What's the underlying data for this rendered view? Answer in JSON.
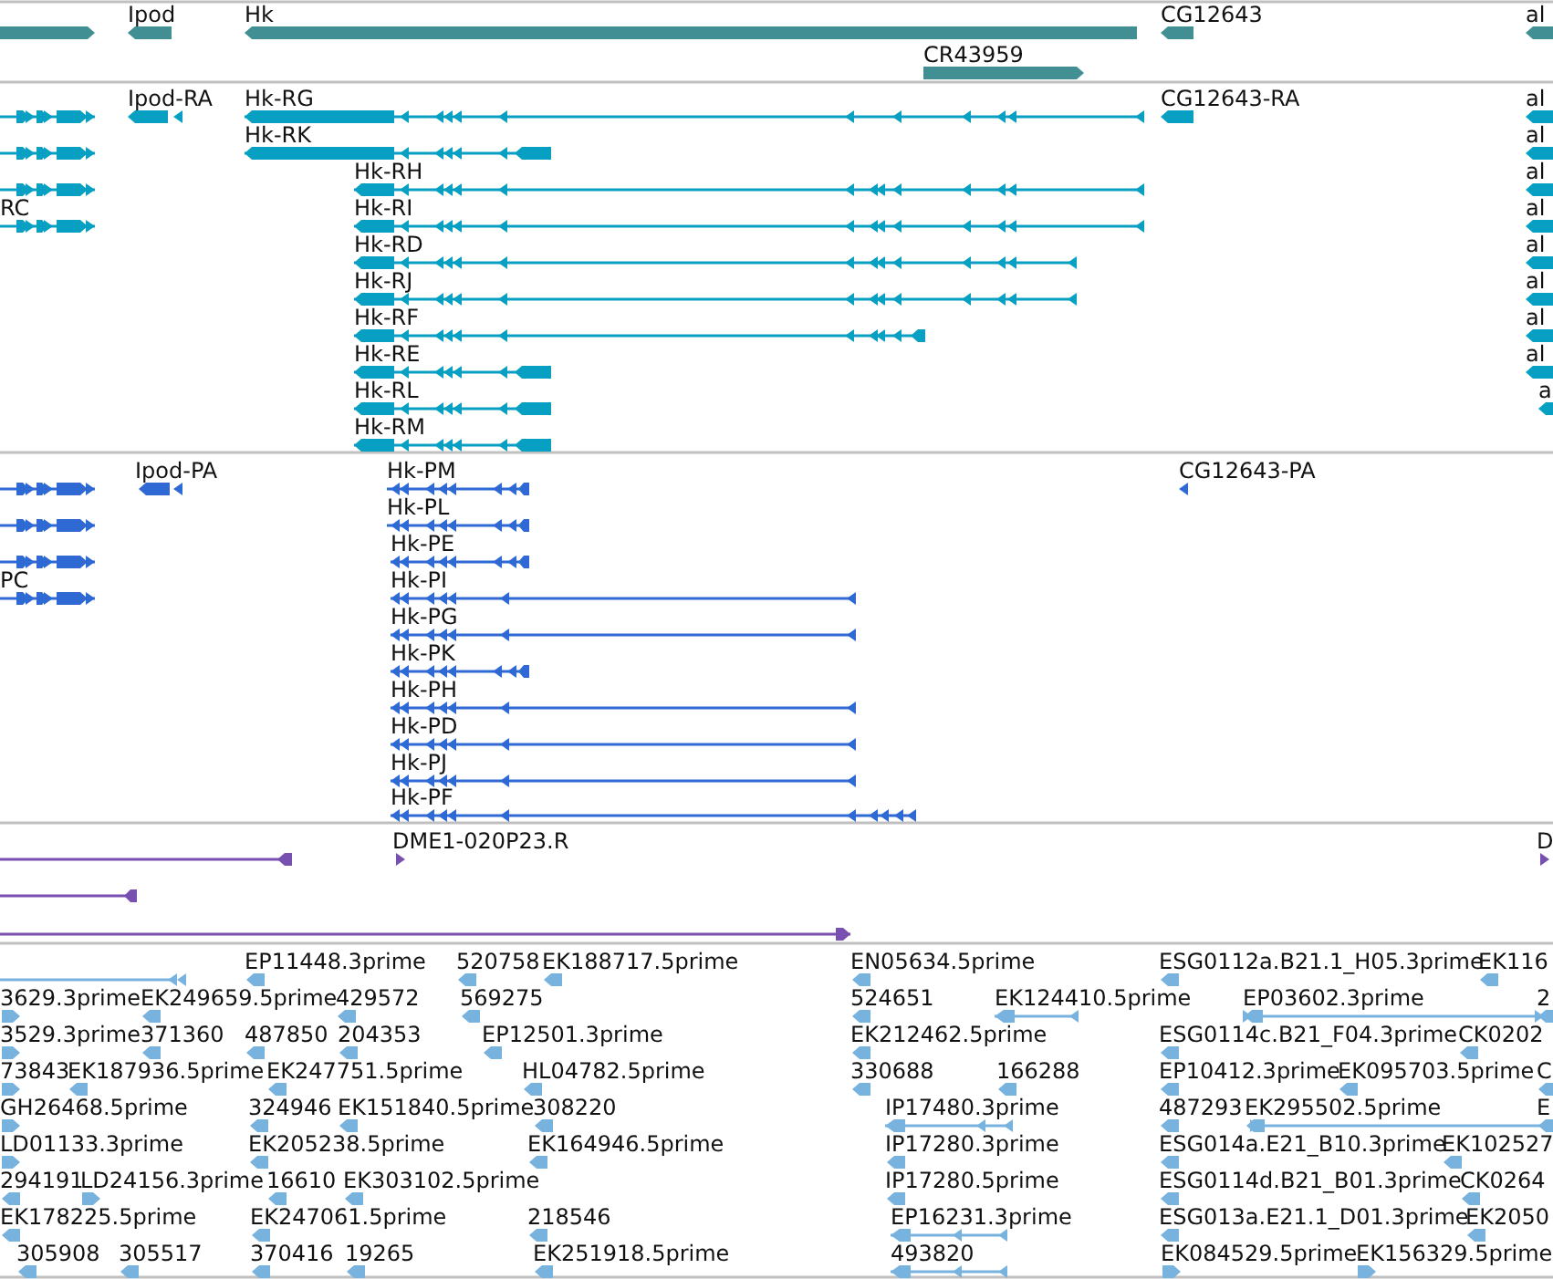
{
  "tracks": [
    {
      "kind": "gene",
      "labels": [
        "Ipod",
        "Hk",
        "CR43959",
        "CG12643",
        "al"
      ]
    },
    {
      "kind": "transcript",
      "labels": [
        "Ipod-RA",
        "Hk-RG",
        "Hk-RK",
        "Hk-RH",
        "Hk-RI",
        "Hk-RD",
        "Hk-RJ",
        "Hk-RF",
        "Hk-RE",
        "Hk-RL",
        "Hk-RM",
        "CG12643-RA",
        "RC",
        "al",
        "al",
        "al",
        "al",
        "al",
        "al",
        "al",
        "al",
        "a"
      ]
    },
    {
      "kind": "protein",
      "labels": [
        "Ipod-PA",
        "Hk-PM",
        "Hk-PL",
        "Hk-PE",
        "Hk-PI",
        "Hk-PG",
        "Hk-PK",
        "Hk-PH",
        "Hk-PD",
        "Hk-PJ",
        "Hk-PF",
        "CG12643-PA",
        "PC"
      ]
    },
    {
      "kind": "clone",
      "labels": [
        "DME1-020P23.R",
        "D"
      ]
    },
    {
      "kind": "est",
      "labels": [
        "EP11448.3prime",
        "520758",
        "EK188717.5prime",
        "EN05634.5prime",
        "ESG0112a.B21.1_H05.3prime",
        "EK116",
        "3629.3prime",
        "EK249659.5prime",
        "429572",
        "569275",
        "524651",
        "EK124410.5prime",
        "EP03602.3prime",
        "2",
        "3529.3prime",
        "371360",
        "487850",
        "204353",
        "EP12501.3prime",
        "EK212462.5prime",
        "ESG0114c.B21_F04.3prime",
        "CK0202",
        "73843",
        "EK187936.5prime",
        "EK247751.5prime",
        "HL04782.5prime",
        "330688",
        "166288",
        "EP10412.3prime",
        "EK095703.5prime",
        "C",
        "GH26468.5prime",
        "324946",
        "EK151840.5prime",
        "308220",
        "IP17480.3prime",
        "487293",
        "EK295502.5prime",
        "E",
        "LD01133.3prime",
        "EK205238.5prime",
        "EK164946.5prime",
        "IP17280.3prime",
        "ESG014a.E21_B10.3prime",
        "EK102527",
        "294191",
        "LD24156.3prime",
        "16610",
        "EK303102.5prime",
        "IP17280.5prime",
        "ESG0114d.B21_B01.3prime",
        "CK0264",
        "EK178225.5prime",
        "EK247061.5prime",
        "218546",
        "EP16231.3prime",
        "ESG013a.E21.1_D01.3prime",
        "EK2050",
        "305908",
        "305517",
        "370416",
        "19265",
        "EK251918.5prime",
        "493820",
        "EK084529.5prime",
        "EK156329.5prime"
      ]
    }
  ]
}
